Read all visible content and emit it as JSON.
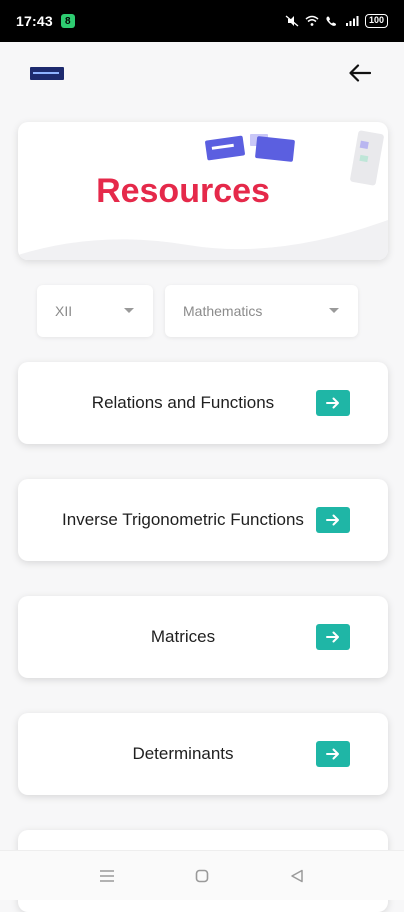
{
  "status_bar": {
    "time": "17:43",
    "notif_badge": "8",
    "battery": "100"
  },
  "banner": {
    "title": "Resources"
  },
  "filters": {
    "class_value": "XII",
    "subject_value": "Mathematics"
  },
  "chapters": [
    {
      "label": "Relations and Functions"
    },
    {
      "label": "Inverse Trigonometric Functions"
    },
    {
      "label": "Matrices"
    },
    {
      "label": "Determinants"
    },
    {
      "label": ""
    }
  ],
  "colors": {
    "accent_red": "#e5294a",
    "button_teal": "#1fb6a6"
  }
}
